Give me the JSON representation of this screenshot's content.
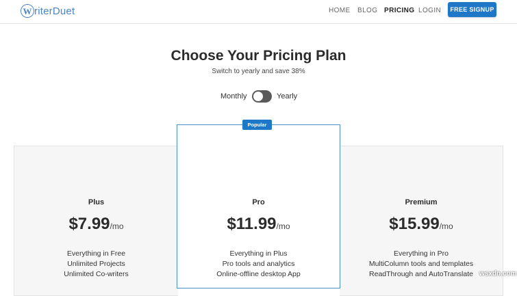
{
  "brand": {
    "logo_letter": "W",
    "logo_text": "riterDuet",
    "accent": "#1f77c7"
  },
  "nav": {
    "home": "HOME",
    "blog": "BLOG",
    "pricing": "PRICING",
    "login": "LOGIN",
    "signup": "FREE SIGNUP"
  },
  "hero": {
    "title": "Choose Your Pricing Plan",
    "subtitle": "Switch to yearly and save 38%"
  },
  "billing_toggle": {
    "monthly_label": "Monthly",
    "yearly_label": "Yearly",
    "selected": "Monthly"
  },
  "plans": [
    {
      "name": "Plus",
      "price": "$7.99",
      "period": "/mo",
      "features": [
        "Everything in Free",
        "Unlimited Projects",
        "Unlimited Co-writers"
      ]
    },
    {
      "name": "Pro",
      "price": "$11.99",
      "period": "/mo",
      "badge": "Popular",
      "features": [
        "Everything in Plus",
        "Pro tools and analytics",
        "Online-offline desktop App"
      ]
    },
    {
      "name": "Premium",
      "price": "$15.99",
      "period": "/mo",
      "features": [
        "Everything in Pro",
        "MultiColumn tools and templates",
        "ReadThrough and AutoTranslate"
      ]
    }
  ],
  "watermark": "wsxdn.com"
}
